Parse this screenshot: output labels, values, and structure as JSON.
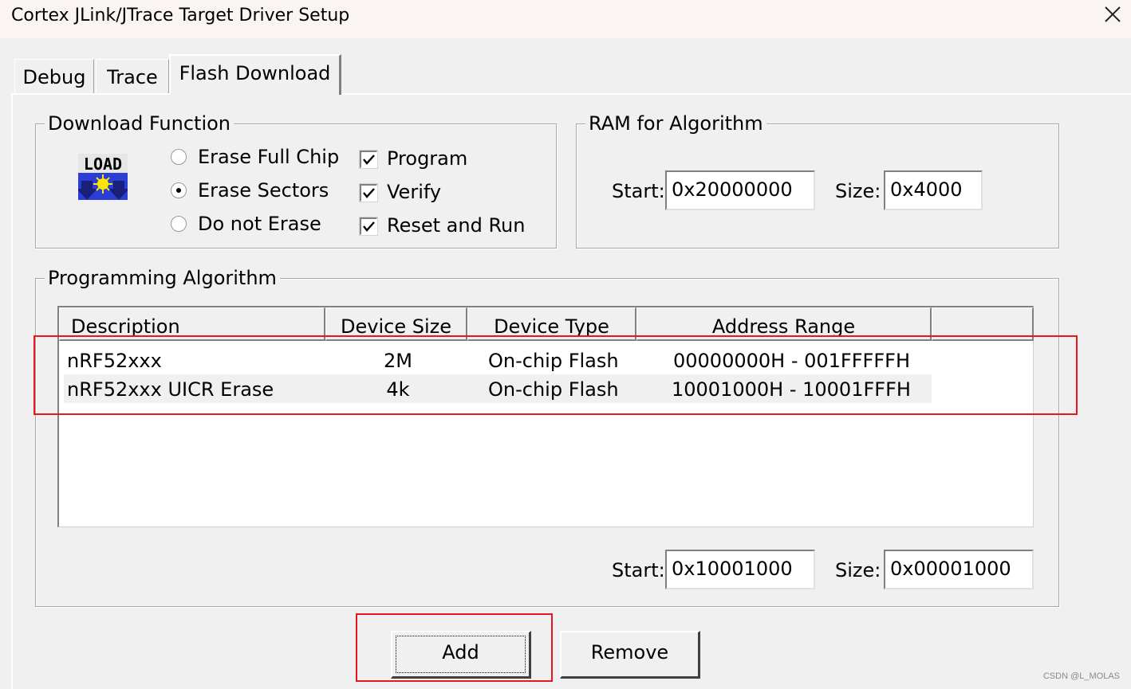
{
  "window": {
    "title": "Cortex JLink/JTrace Target Driver Setup"
  },
  "tabs": [
    "Debug",
    "Trace",
    "Flash Download"
  ],
  "download_function": {
    "legend": "Download Function",
    "icon_text": "LOAD",
    "erase_options": [
      {
        "label": "Erase Full Chip",
        "selected": false
      },
      {
        "label": "Erase Sectors",
        "selected": true
      },
      {
        "label": "Do not Erase",
        "selected": false
      }
    ],
    "checks": [
      {
        "label": "Program",
        "checked": true
      },
      {
        "label": "Verify",
        "checked": true
      },
      {
        "label": "Reset and Run",
        "checked": true
      }
    ]
  },
  "ram_for_algorithm": {
    "legend": "RAM for Algorithm",
    "start_label": "Start:",
    "start_value": "0x20000000",
    "size_label": "Size:",
    "size_value": "0x4000"
  },
  "programming_algorithm": {
    "legend": "Programming Algorithm",
    "columns": [
      "Description",
      "Device Size",
      "Device Type",
      "Address Range"
    ],
    "rows": [
      [
        "nRF52xxx",
        "2M",
        "On-chip Flash",
        "00000000H - 001FFFFFH"
      ],
      [
        "nRF52xxx UICR Erase",
        "4k",
        "On-chip Flash",
        "10001000H - 10001FFFH"
      ]
    ],
    "start_label": "Start:",
    "start_value": "0x10001000",
    "size_label": "Size:",
    "size_value": "0x00001000"
  },
  "buttons": {
    "add": "Add",
    "remove": "Remove"
  },
  "watermark": "CSDN @L_MOLAS",
  "colors": {
    "highlight": "#e8161e",
    "dialog_bg": "#f0f0f0",
    "title_bg": "#faf5f3"
  }
}
